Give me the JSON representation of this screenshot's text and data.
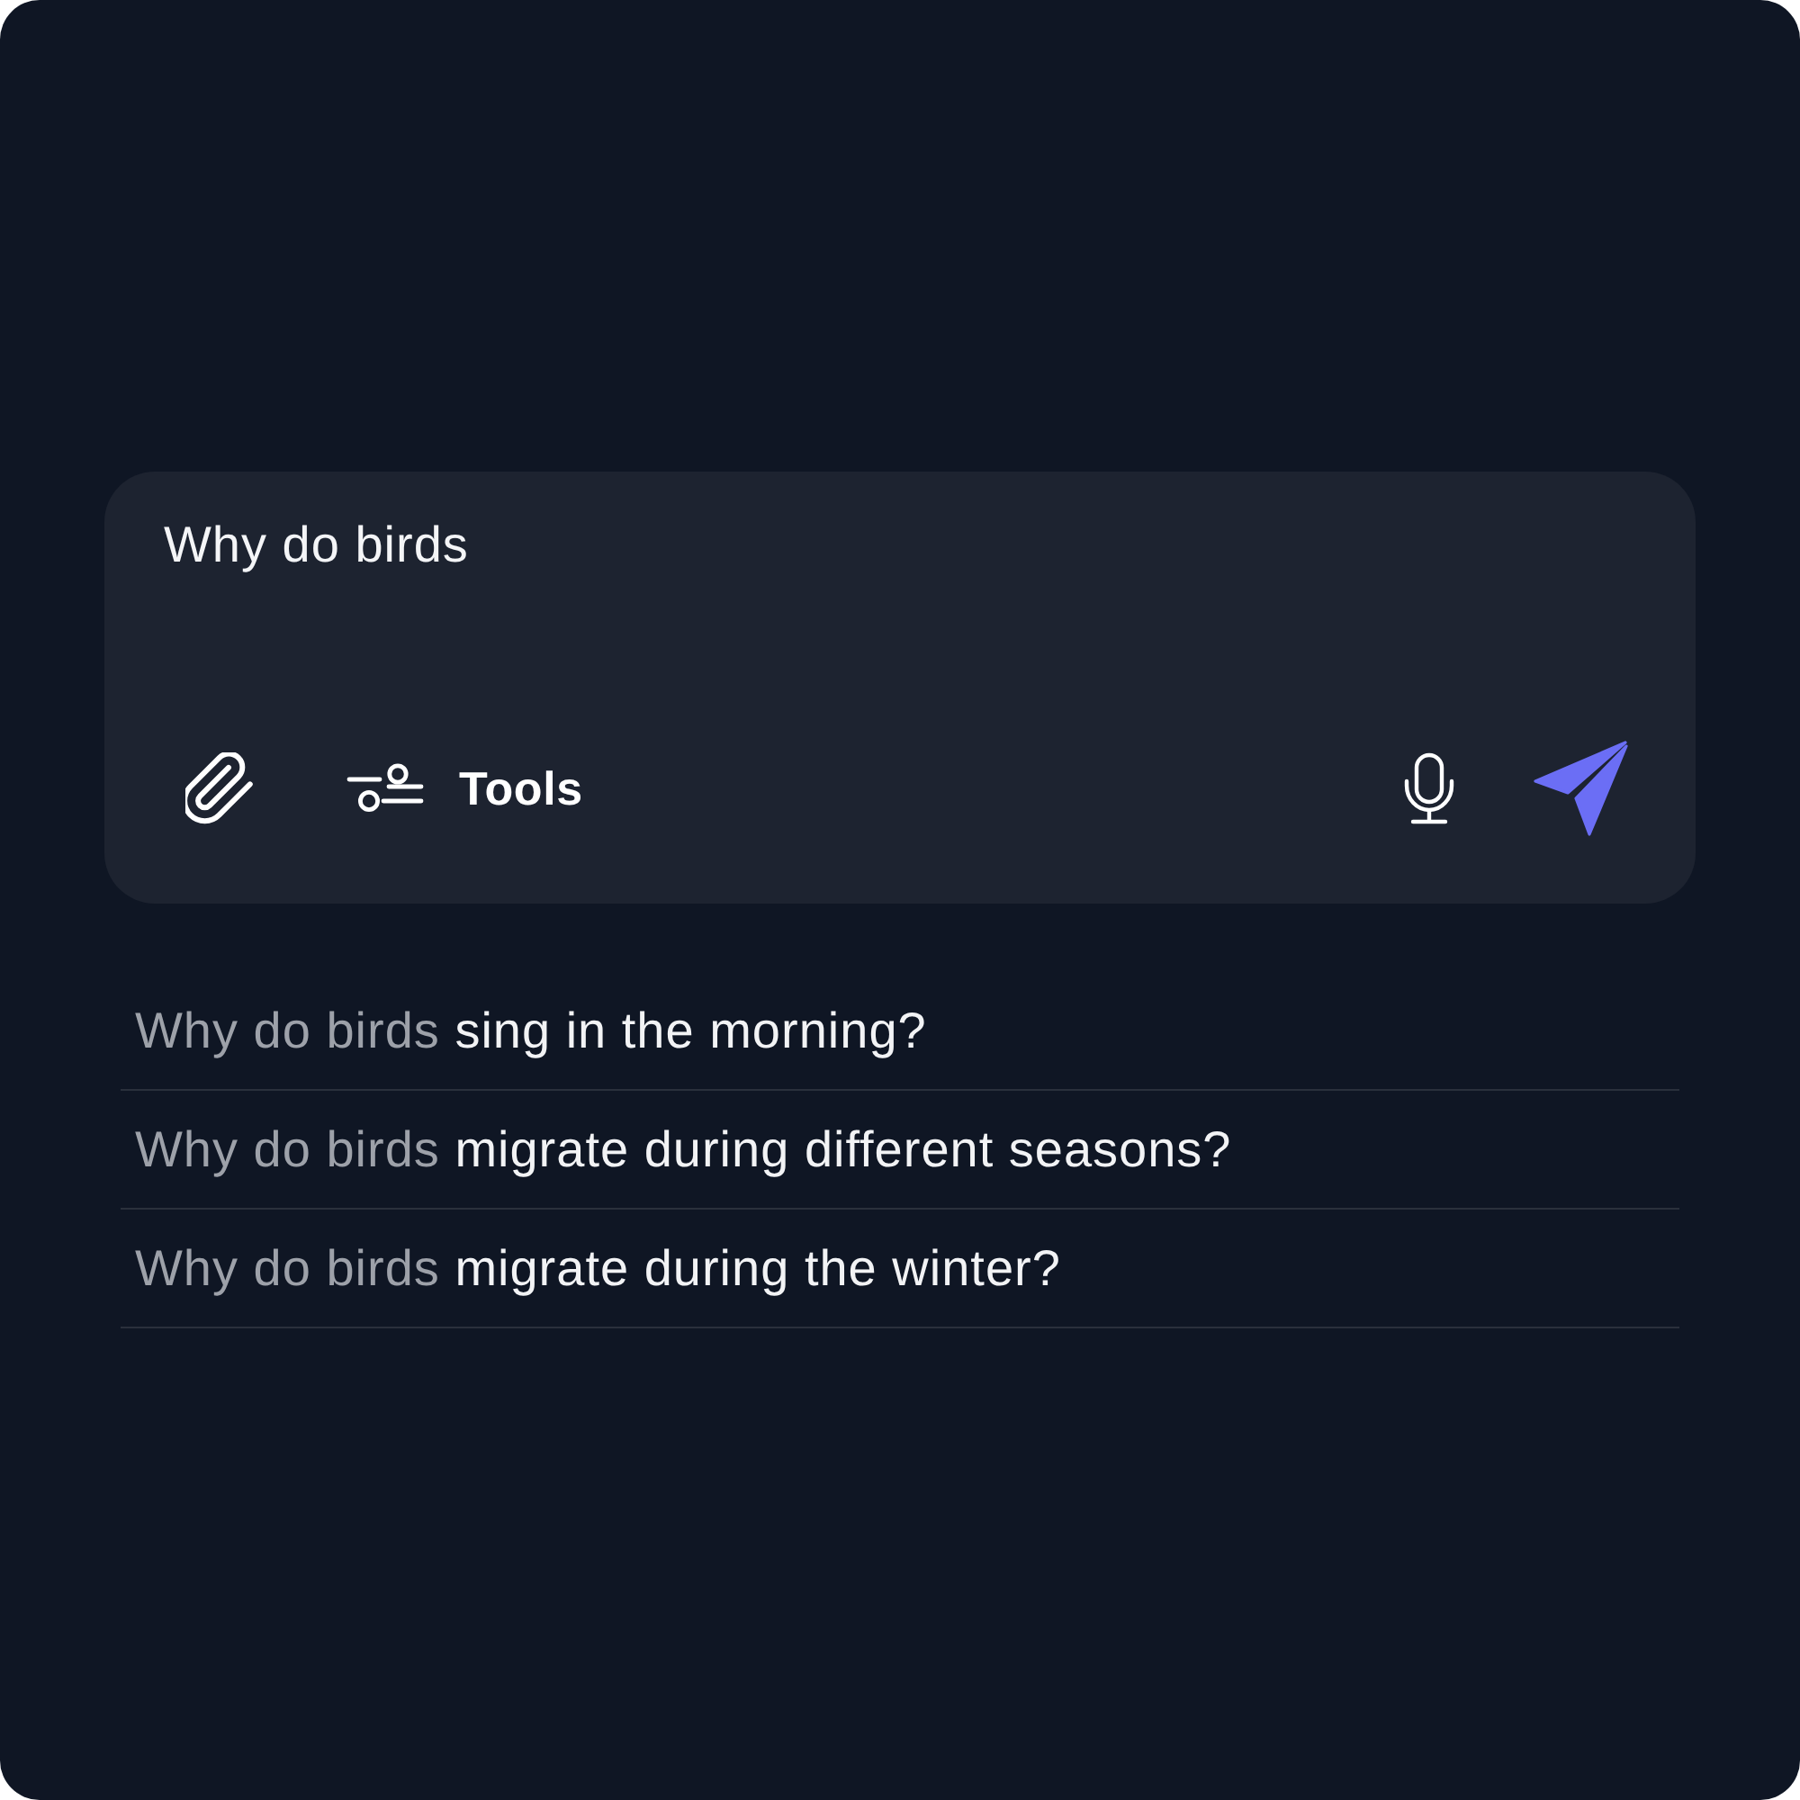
{
  "composer": {
    "input": {
      "value": "Why do birds"
    },
    "toolbar": {
      "tools_label": "Tools"
    }
  },
  "suggestions": [
    {
      "typed": "Why do birds",
      "completion": "sing in the morning?"
    },
    {
      "typed": "Why do birds",
      "completion": "migrate during different seasons?"
    },
    {
      "typed": "Why do birds",
      "completion": "migrate during the winter?"
    }
  ]
}
